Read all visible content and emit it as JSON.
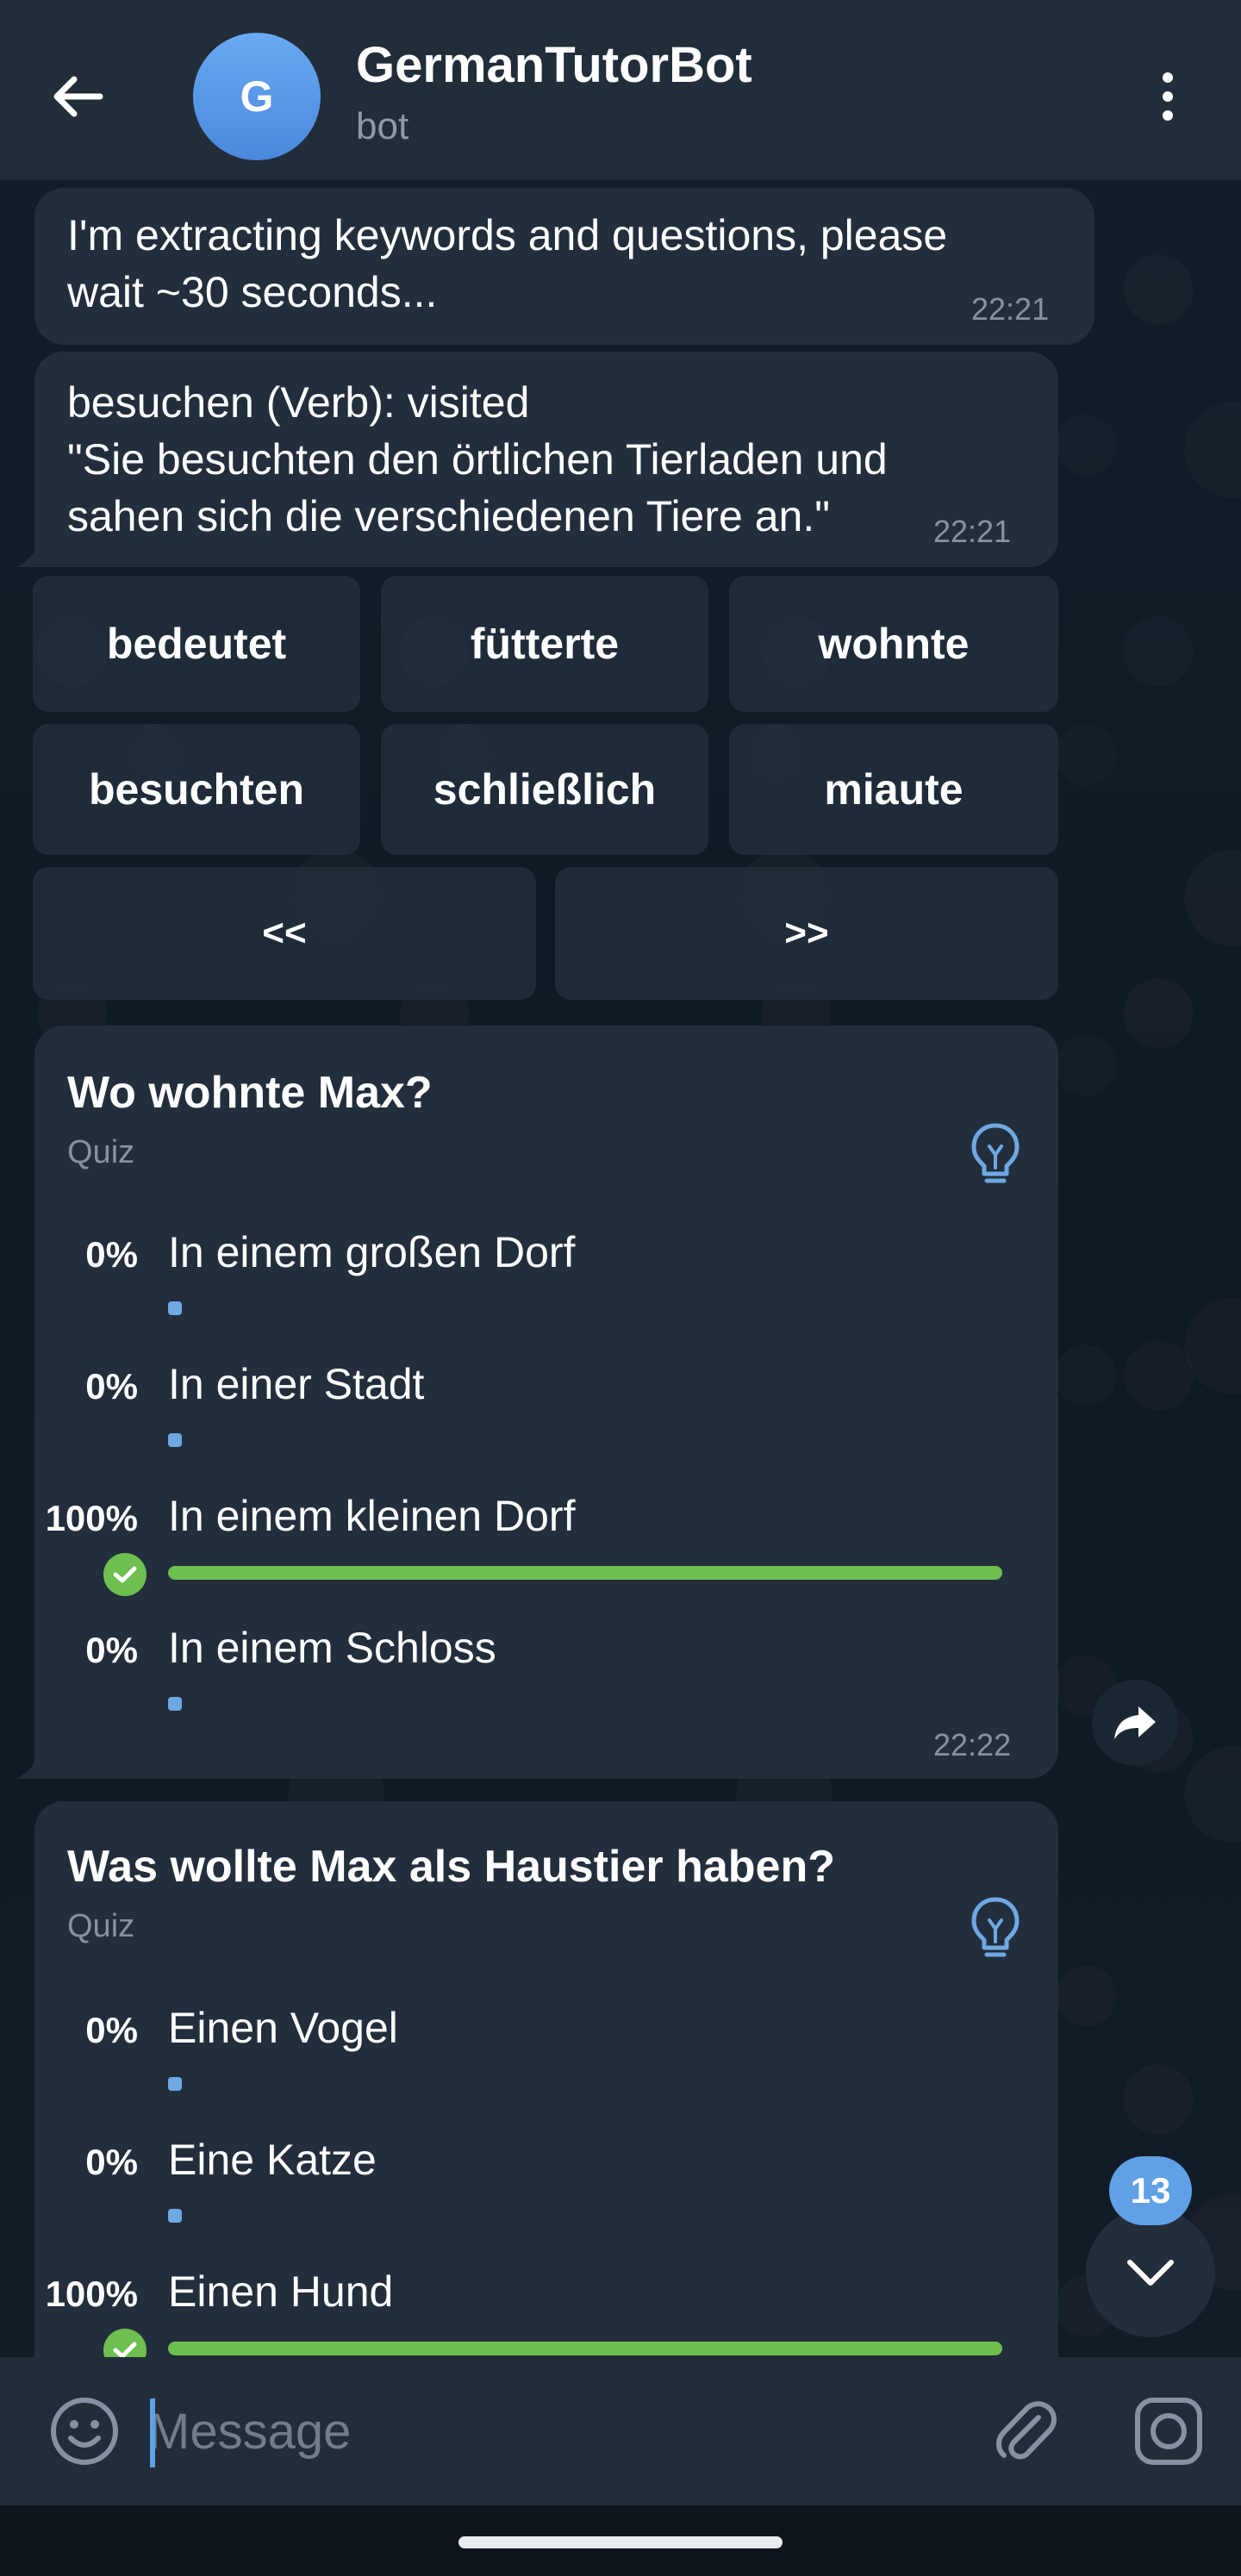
{
  "header": {
    "title": "GermanTutorBot",
    "subtitle": "bot",
    "avatar_letter": "G"
  },
  "messages": [
    {
      "text": "I'm extracting keywords and questions, please\nwait ~30 seconds...",
      "time": "22:21"
    },
    {
      "text": "besuchen (Verb): visited\n\"Sie besuchten den örtlichen Tierladen und\nsahen sich die verschiedenen Tiere an.\"",
      "time": "22:21"
    }
  ],
  "keyboard": {
    "row1": [
      "bedeutet",
      "fütterte",
      "wohnte"
    ],
    "row2": [
      "besuchten",
      "schließlich",
      "miaute"
    ],
    "nav": [
      "<<",
      ">>"
    ]
  },
  "quizzes": [
    {
      "question": "Wo wohnte Max?",
      "type": "Quiz",
      "time": "22:22",
      "options": [
        {
          "pct": "0%",
          "text": "In einem großen Dorf",
          "value": 0,
          "correct": false
        },
        {
          "pct": "0%",
          "text": "In einer Stadt",
          "value": 0,
          "correct": false
        },
        {
          "pct": "100%",
          "text": "In einem kleinen Dorf",
          "value": 100,
          "correct": true
        },
        {
          "pct": "0%",
          "text": "In einem Schloss",
          "value": 0,
          "correct": false
        }
      ]
    },
    {
      "question": "Was wollte Max als Haustier haben?",
      "type": "Quiz",
      "options": [
        {
          "pct": "0%",
          "text": "Einen Vogel",
          "value": 0,
          "correct": false
        },
        {
          "pct": "0%",
          "text": "Eine Katze",
          "value": 0,
          "correct": false
        },
        {
          "pct": "100%",
          "text": "Einen Hund",
          "value": 100,
          "correct": true
        }
      ]
    }
  ],
  "scroll_badge": "13",
  "input": {
    "placeholder": "Message"
  },
  "colors": {
    "header": "#222d3a",
    "bubble": "#232e3c",
    "accent": "#5fa0e6",
    "correct": "#6dbf4f"
  }
}
